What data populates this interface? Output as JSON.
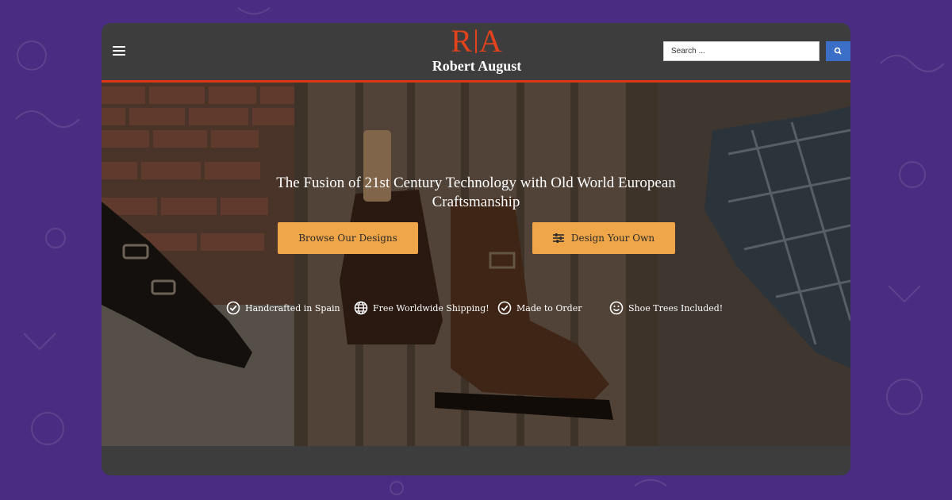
{
  "header": {
    "logo_mark": "R A",
    "logo_name": "Robert August",
    "search_placeholder": "Search ..."
  },
  "hero": {
    "headline": "The Fusion of 21st Century Technology with Old World European Craftsmanship",
    "buttons": {
      "browse": "Browse Our Designs",
      "design": "Design Your Own"
    },
    "features": [
      {
        "label": "Handcrafted in Spain",
        "icon": "check-circle-icon"
      },
      {
        "label": "Free Worldwide Shipping!",
        "icon": "globe-icon"
      },
      {
        "label": "Made to Order",
        "icon": "check-circle-icon"
      },
      {
        "label": "Shoe Trees Included!",
        "icon": "smile-icon"
      }
    ]
  },
  "colors": {
    "page_background": "#4a2d82",
    "window": "#3d3d3d",
    "accent_red": "#e2421c",
    "button_orange": "#eea648",
    "search_blue": "#3b6fc7"
  }
}
